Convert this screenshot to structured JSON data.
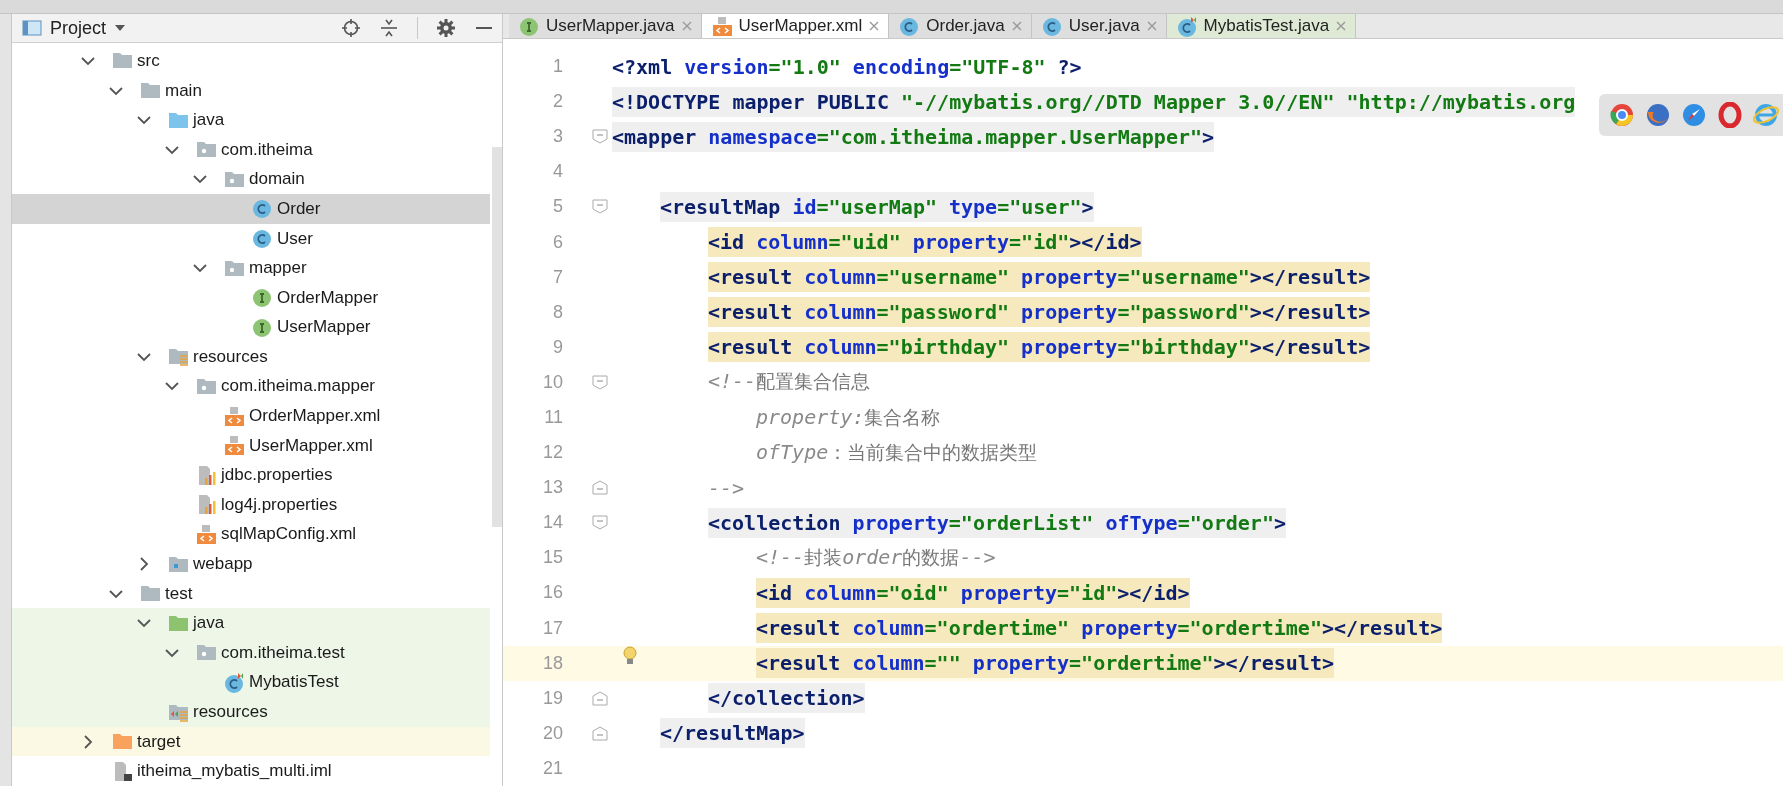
{
  "project_panel": {
    "title": "Project",
    "tree": [
      {
        "label": "src",
        "kind": "folder",
        "expanded": true,
        "selected": false,
        "children": [
          {
            "label": "main",
            "kind": "folder",
            "expanded": true,
            "selected": false,
            "children": [
              {
                "label": "java",
                "kind": "source-folder",
                "expanded": true,
                "selected": false,
                "children": [
                  {
                    "label": "com.itheima",
                    "kind": "package",
                    "expanded": true,
                    "selected": false,
                    "children": [
                      {
                        "label": "domain",
                        "kind": "package",
                        "expanded": true,
                        "selected": false,
                        "children": [
                          {
                            "label": "Order",
                            "kind": "class",
                            "selected": true
                          },
                          {
                            "label": "User",
                            "kind": "class",
                            "selected": false
                          }
                        ]
                      },
                      {
                        "label": "mapper",
                        "kind": "package",
                        "expanded": true,
                        "selected": false,
                        "children": [
                          {
                            "label": "OrderMapper",
                            "kind": "interface",
                            "selected": false
                          },
                          {
                            "label": "UserMapper",
                            "kind": "interface",
                            "selected": false
                          }
                        ]
                      }
                    ]
                  }
                ]
              },
              {
                "label": "resources",
                "kind": "resources-folder",
                "expanded": true,
                "selected": false,
                "children": [
                  {
                    "label": "com.itheima.mapper",
                    "kind": "package",
                    "expanded": true,
                    "selected": false,
                    "children": [
                      {
                        "label": "OrderMapper.xml",
                        "kind": "xml",
                        "selected": false
                      },
                      {
                        "label": "UserMapper.xml",
                        "kind": "xml",
                        "selected": false
                      }
                    ]
                  },
                  {
                    "label": "jdbc.properties",
                    "kind": "properties",
                    "selected": false
                  },
                  {
                    "label": "log4j.properties",
                    "kind": "properties",
                    "selected": false
                  },
                  {
                    "label": "sqlMapConfig.xml",
                    "kind": "xml",
                    "selected": false
                  }
                ]
              },
              {
                "label": "webapp",
                "kind": "web-folder",
                "expanded": false,
                "selected": false
              }
            ]
          },
          {
            "label": "test",
            "kind": "folder",
            "expanded": true,
            "selected": false,
            "children": [
              {
                "label": "java",
                "kind": "test-folder",
                "expanded": true,
                "selected": false,
                "color": "#eef6e8",
                "children": [
                  {
                    "label": "com.itheima.test",
                    "kind": "package",
                    "expanded": true,
                    "selected": false,
                    "color": "#eef6e8",
                    "children": [
                      {
                        "label": "MybatisTest",
                        "kind": "test-class",
                        "selected": false,
                        "color": "#eef6e8"
                      }
                    ]
                  }
                ]
              },
              {
                "label": "resources",
                "kind": "test-resources-folder",
                "selected": false,
                "color": "#eef6e8"
              }
            ]
          }
        ]
      },
      {
        "label": "target",
        "kind": "excluded-folder",
        "expanded": false,
        "selected": false,
        "color": "#fbf9e4"
      },
      {
        "label": "itheima_mybatis_multi.iml",
        "kind": "module-file",
        "selected": false
      }
    ]
  },
  "tabs": [
    {
      "label": "UserMapper.java",
      "kind": "interface",
      "selected": false
    },
    {
      "label": "UserMapper.xml",
      "kind": "xml",
      "selected": true
    },
    {
      "label": "Order.java",
      "kind": "class",
      "selected": false
    },
    {
      "label": "User.java",
      "kind": "class",
      "selected": false
    },
    {
      "label": "MybatisTest.java",
      "kind": "test-class",
      "selected": false,
      "color": "#dfead6"
    }
  ],
  "editor": {
    "lines": [
      {
        "number": "1",
        "kind": "plain",
        "tokens": [
          {
            "kind": "tag",
            "text": "<?xml "
          },
          {
            "kind": "attr",
            "text": "version"
          },
          {
            "kind": "value",
            "text": "=\"1.0\" "
          },
          {
            "kind": "attr",
            "text": "encoding"
          },
          {
            "kind": "value",
            "text": "=\"UTF-8\" "
          },
          {
            "kind": "tag",
            "text": "?>"
          }
        ]
      },
      {
        "number": "2",
        "kind": "tag",
        "tokens": [
          {
            "kind": "tag",
            "text": "<!DOCTYPE mapper PUBLIC "
          },
          {
            "kind": "value",
            "text": "\"-//mybatis.org//DTD Mapper 3.0//EN\" \"http://mybatis.org"
          }
        ]
      },
      {
        "number": "3",
        "fold_open": true,
        "kind": "tag",
        "tokens": [
          {
            "kind": "tag",
            "text": "<mapper "
          },
          {
            "kind": "attr",
            "text": "namespace"
          },
          {
            "kind": "value",
            "text": "=\"com.itheima.mapper.UserMapper\""
          },
          {
            "kind": "tag",
            "text": ">"
          }
        ],
        "children": [
          {
            "number": "4"
          },
          {
            "number": "5",
            "fold_open": true,
            "kind": "tag",
            "tokens": [
              {
                "kind": "tag",
                "text": "<resultMap "
              },
              {
                "kind": "attr",
                "text": "id"
              },
              {
                "kind": "value",
                "text": "=\"userMap\" "
              },
              {
                "kind": "attr",
                "text": "type"
              },
              {
                "kind": "value",
                "text": "=\"user\""
              },
              {
                "kind": "tag",
                "text": ">"
              }
            ],
            "children": [
              {
                "number": "6",
                "kind": "match",
                "tokens": [
                  {
                    "kind": "tag",
                    "text": "<id "
                  },
                  {
                    "kind": "attr",
                    "text": "column"
                  },
                  {
                    "kind": "value",
                    "text": "=\"uid\" "
                  },
                  {
                    "kind": "attr",
                    "text": "property"
                  },
                  {
                    "kind": "value",
                    "text": "=\"id\""
                  },
                  {
                    "kind": "tag",
                    "text": "></id>"
                  }
                ]
              },
              {
                "number": "7",
                "kind": "match",
                "tokens": [
                  {
                    "kind": "tag",
                    "text": "<result "
                  },
                  {
                    "kind": "attr",
                    "text": "column"
                  },
                  {
                    "kind": "value",
                    "text": "=\"username\" "
                  },
                  {
                    "kind": "attr",
                    "text": "property"
                  },
                  {
                    "kind": "value",
                    "text": "=\"username\""
                  },
                  {
                    "kind": "tag",
                    "text": "></result>"
                  }
                ]
              },
              {
                "number": "8",
                "kind": "match",
                "tokens": [
                  {
                    "kind": "tag",
                    "text": "<result "
                  },
                  {
                    "kind": "attr",
                    "text": "column"
                  },
                  {
                    "kind": "value",
                    "text": "=\"password\" "
                  },
                  {
                    "kind": "attr",
                    "text": "property"
                  },
                  {
                    "kind": "value",
                    "text": "=\"password\""
                  },
                  {
                    "kind": "tag",
                    "text": "></result>"
                  }
                ]
              },
              {
                "number": "9",
                "kind": "match",
                "tokens": [
                  {
                    "kind": "tag",
                    "text": "<result "
                  },
                  {
                    "kind": "attr",
                    "text": "column"
                  },
                  {
                    "kind": "value",
                    "text": "=\"birthday\" "
                  },
                  {
                    "kind": "attr",
                    "text": "property"
                  },
                  {
                    "kind": "value",
                    "text": "=\"birthday\""
                  },
                  {
                    "kind": "tag",
                    "text": "></result>"
                  }
                ]
              },
              {
                "number": "10",
                "fold_open": true,
                "kind": "plain",
                "tokens": [
                  {
                    "kind": "comment",
                    "text": "<!--"
                  },
                  {
                    "kind": "comment-text",
                    "text": "配置集合信息"
                  }
                ],
                "children": [
                  {
                    "number": "11",
                    "kind": "plain",
                    "tokens": [
                      {
                        "kind": "comment",
                        "text": "property:"
                      },
                      {
                        "kind": "comment-text",
                        "text": "集合名称"
                      }
                    ]
                  },
                  {
                    "number": "12",
                    "kind": "plain",
                    "tokens": [
                      {
                        "kind": "comment",
                        "text": "ofType"
                      },
                      {
                        "kind": "comment-text",
                        "text": "：当前集合中的数据类型"
                      }
                    ]
                  }
                ]
              },
              {
                "number": "13",
                "fold_close": true,
                "kind": "plain",
                "tokens": [
                  {
                    "kind": "comment",
                    "text": "-->"
                  }
                ]
              },
              {
                "number": "14",
                "fold_open": true,
                "kind": "tag",
                "tokens": [
                  {
                    "kind": "tag",
                    "text": "<collection "
                  },
                  {
                    "kind": "attr",
                    "text": "property"
                  },
                  {
                    "kind": "value",
                    "text": "=\"orderList\" "
                  },
                  {
                    "kind": "attr",
                    "text": "ofType"
                  },
                  {
                    "kind": "value",
                    "text": "=\"order\""
                  },
                  {
                    "kind": "tag",
                    "text": ">"
                  }
                ],
                "children": [
                  {
                    "number": "15",
                    "kind": "plain",
                    "tokens": [
                      {
                        "kind": "comment",
                        "text": "<!--"
                      },
                      {
                        "kind": "comment-text",
                        "text": "封装"
                      },
                      {
                        "kind": "comment",
                        "text": "order"
                      },
                      {
                        "kind": "comment-text",
                        "text": "的数据"
                      },
                      {
                        "kind": "comment",
                        "text": "-->"
                      }
                    ]
                  },
                  {
                    "number": "16",
                    "kind": "match",
                    "tokens": [
                      {
                        "kind": "tag",
                        "text": "<id "
                      },
                      {
                        "kind": "attr",
                        "text": "column"
                      },
                      {
                        "kind": "value",
                        "text": "=\"oid\" "
                      },
                      {
                        "kind": "attr",
                        "text": "property"
                      },
                      {
                        "kind": "value",
                        "text": "=\"id\""
                      },
                      {
                        "kind": "tag",
                        "text": "></id>"
                      }
                    ]
                  },
                  {
                    "number": "17",
                    "kind": "match",
                    "tokens": [
                      {
                        "kind": "tag",
                        "text": "<result "
                      },
                      {
                        "kind": "attr",
                        "text": "column"
                      },
                      {
                        "kind": "value",
                        "text": "=\"ordertime\" "
                      },
                      {
                        "kind": "attr",
                        "text": "property"
                      },
                      {
                        "kind": "value",
                        "text": "=\"ordertime\""
                      },
                      {
                        "kind": "tag",
                        "text": "></result>"
                      }
                    ]
                  },
                  {
                    "number": "18",
                    "kind": "match",
                    "current": true,
                    "bulb": true,
                    "tokens": [
                      {
                        "kind": "tag",
                        "text": "<result "
                      },
                      {
                        "kind": "attr",
                        "text": "column"
                      },
                      {
                        "kind": "value",
                        "text": "=\"\" "
                      },
                      {
                        "kind": "attr",
                        "text": "property"
                      },
                      {
                        "kind": "value",
                        "text": "=\"ordertime\""
                      },
                      {
                        "kind": "tag",
                        "text": "></result>"
                      }
                    ]
                  }
                ]
              },
              {
                "number": "19",
                "fold_close": true,
                "kind": "tag",
                "tokens": [
                  {
                    "kind": "tag",
                    "text": "</collection>"
                  }
                ]
              }
            ]
          },
          {
            "number": "20",
            "fold_close": true,
            "kind": "tag",
            "tokens": [
              {
                "kind": "tag",
                "text": "</resultMap>"
              }
            ]
          }
        ]
      },
      {
        "number": "21"
      }
    ]
  },
  "browser_popup": {
    "items": [
      {
        "kind": "ring"
      },
      {
        "kind": "fox"
      },
      {
        "kind": "compass"
      },
      {
        "kind": "letter-ring"
      },
      {
        "kind": "orbit"
      }
    ]
  }
}
